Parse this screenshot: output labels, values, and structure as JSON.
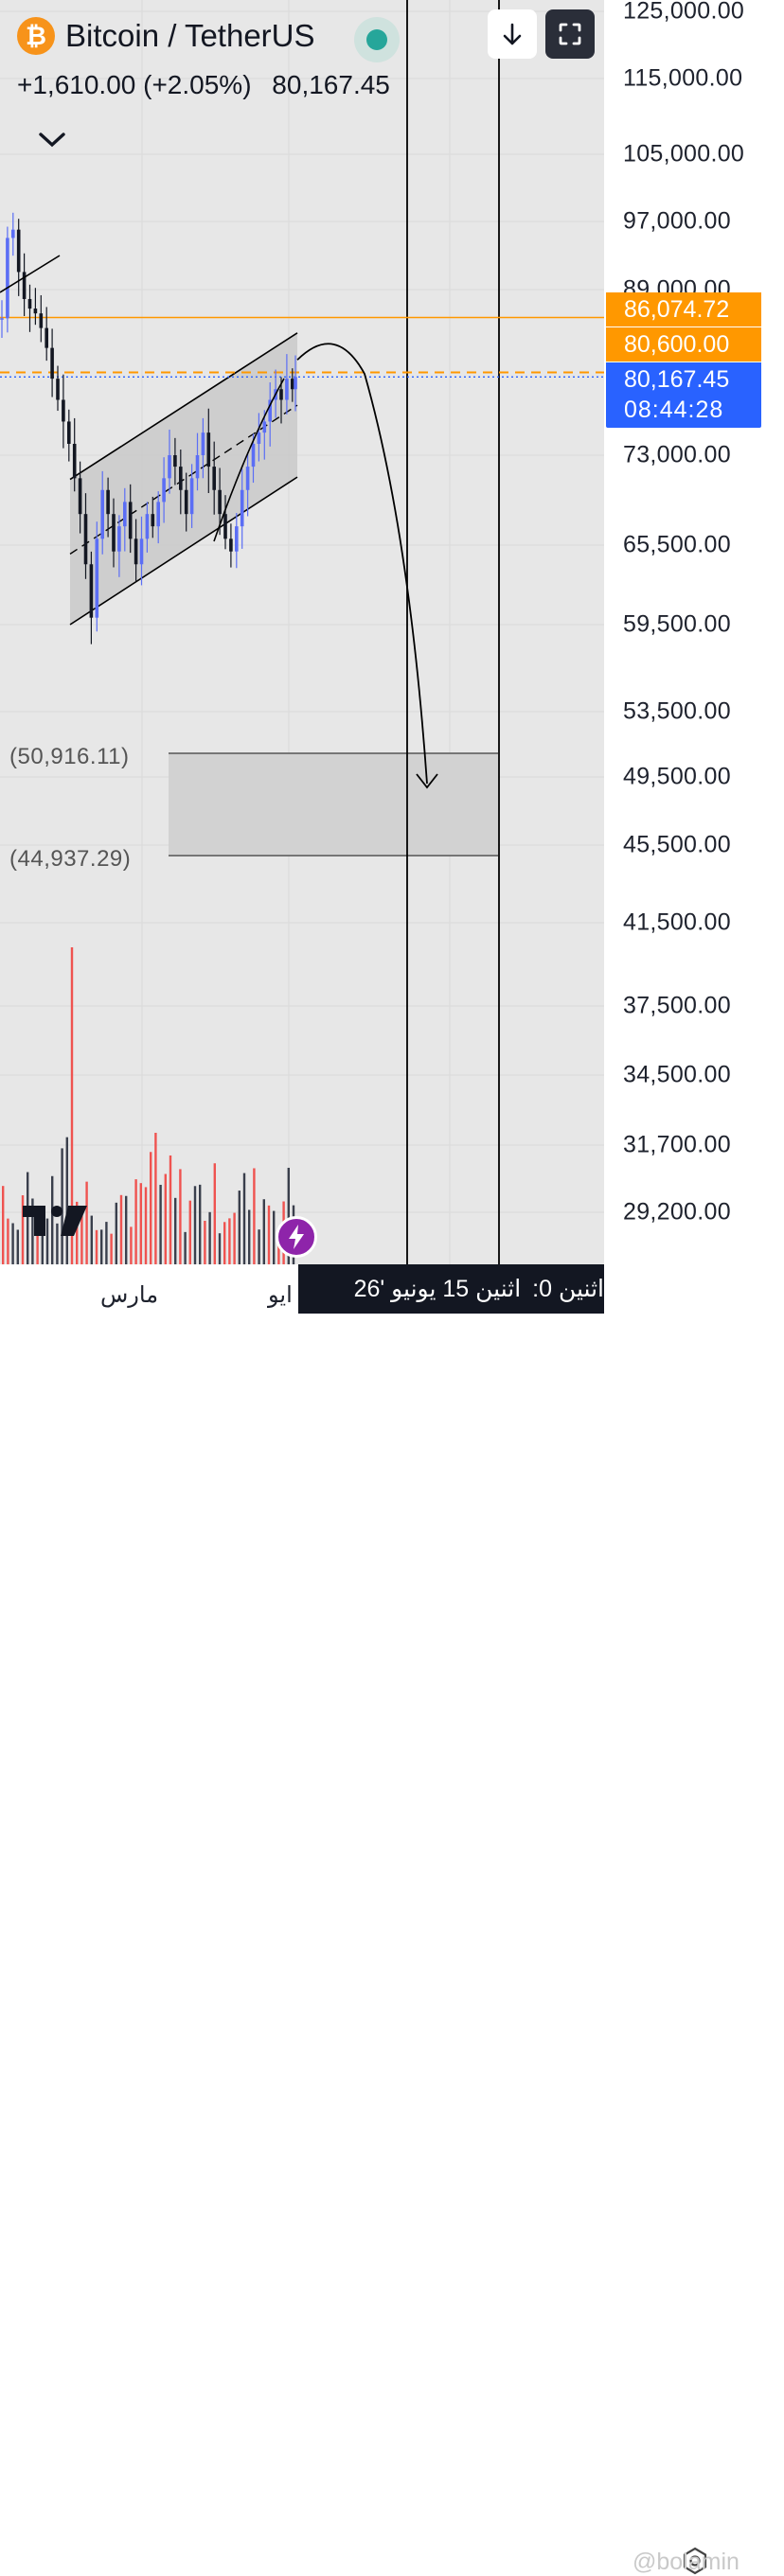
{
  "header": {
    "symbol": "Bitcoin / TetherUS",
    "logo_glyph": "₿",
    "change": "+1,610.00 (+2.05%)",
    "last_price": "80,167.45"
  },
  "price_axis": {
    "ticks": [
      "125,000.00",
      "115,000.00",
      "105,000.00",
      "97,000.00",
      "89,000.00",
      "73,000.00",
      "65,500.00",
      "59,500.00",
      "53,500.00",
      "49,500.00",
      "45,500.00",
      "41,500.00",
      "37,500.00",
      "34,500.00",
      "31,700.00",
      "29,200.00"
    ],
    "tags": {
      "upper": "86,074.72",
      "lower": "80,600.00",
      "last": "80,167.45",
      "countdown": "08:44:28"
    }
  },
  "zone_labels": {
    "top": "(50,916.11)",
    "bottom": "(44,937.29)"
  },
  "time_axis": {
    "labels": [
      "مارس",
      "ايو"
    ],
    "cursor_parts": [
      "اثنين 15 يونيو '26",
      "اثنين 0:"
    ]
  },
  "watermark": "@bolamin",
  "colors": {
    "up": "#5b6ef5",
    "down": "#131722",
    "volume_up": "#3a3f4c",
    "volume_down": "#ef5350",
    "horizontal_line": "#ff9800",
    "last_price": "#2962ff",
    "channel_fill": "#c9c9c9",
    "zone_fill": "#d2d2d2"
  },
  "icons": [
    "bitcoin-logo-icon",
    "chevron-down-icon",
    "arrow-down-icon",
    "fullscreen-icon",
    "tradingview-logo-icon",
    "lightning-icon",
    "settings-icon"
  ],
  "chart_data": {
    "type": "candlestick",
    "instrument": "BTC/USDT",
    "scale": "log",
    "y_ticks": [
      125000,
      115000,
      105000,
      97000,
      89000,
      73000,
      65500,
      59500,
      53500,
      49500,
      45500,
      41500,
      37500,
      34500,
      31700,
      29200
    ],
    "horizontal_levels": [
      86074.72,
      80600.0
    ],
    "last_price": 80167.45,
    "target_zone": [
      50916.11,
      44937.29
    ],
    "channel": {
      "upper": [
        70900,
        84500
      ],
      "lower": [
        59500,
        71100
      ],
      "mid": [
        64800,
        77500
      ]
    },
    "close_path": [
      86000,
      95000,
      96000,
      91000,
      88000,
      87000,
      86500,
      85000,
      83000,
      80000,
      78000,
      76000,
      74000,
      71000,
      68000,
      64000,
      60000,
      66000,
      70000,
      68000,
      65000,
      67000,
      69000,
      66000,
      64000,
      66000,
      68000,
      67000,
      69000,
      71000,
      73000,
      72000,
      70000,
      68000,
      71000,
      73000,
      75000,
      72000,
      70000,
      68000,
      66000,
      65000,
      67000,
      70000,
      72000,
      74000,
      75000,
      76000,
      78000,
      79000,
      78000,
      80000,
      79000,
      80167
    ]
  }
}
